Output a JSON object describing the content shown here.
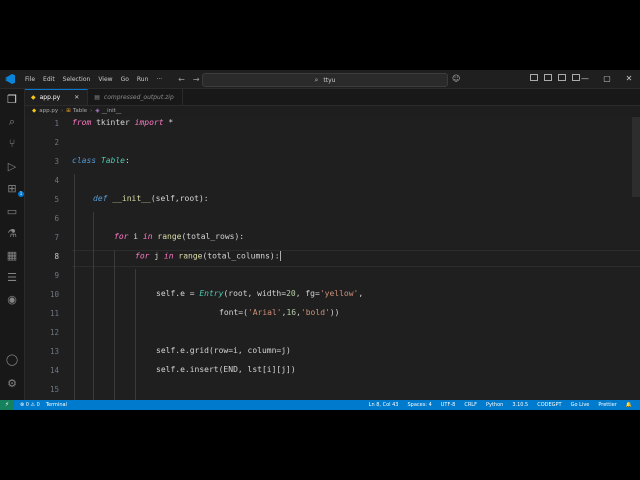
{
  "menu": {
    "file": "File",
    "edit": "Edit",
    "selection": "Selection",
    "view": "View",
    "go": "Go",
    "run": "Run",
    "more": "···"
  },
  "nav": {
    "back": "←",
    "forward": "→"
  },
  "command_center": {
    "text": "ttyu",
    "icon": "search-icon"
  },
  "tabs": [
    {
      "label": "app.py",
      "close": "✕",
      "icon": "python-file-icon"
    },
    {
      "label": "compressed_output.zip",
      "icon": "zip-file-icon"
    }
  ],
  "breadcrumb": {
    "file": "app.py",
    "class": "Table",
    "method": "__init__",
    "sep": "›"
  },
  "code": {
    "l1a": "from",
    "l1b": " tkinter ",
    "l1c": "import",
    "l1d": " *",
    "l3a": "class",
    "l3b": " Table",
    ":": ":",
    "l5a": "def",
    "l5b": "__init__",
    "l5c": "(self,root):",
    "l7a": "for",
    "l7b": " i ",
    "l7c": "in",
    "l7d": "range",
    "l7e": "(total_rows):",
    "l8a": "for",
    "l8b": " j ",
    "l8c": "in",
    "l8d": "range",
    "l8e": "(total_columns):",
    "l10a": "self.e = ",
    "l10b": "Entry",
    "l10c": "(root, width=",
    "l10d": "20",
    ", ": ", ",
    "l10e": "fg",
    "l10f": "=",
    "l10g": "'yellow'",
    "l10h": ",",
    "l11a": "font=(",
    "l11b": "'Arial'",
    "l11c": ",",
    "l11d": "16",
    "l11e": ",",
    "l11f": "'bold'",
    "l11g": "))",
    "l13": "self.e.grid(row=i, column=j)",
    "l14": "self.e.insert(END, lst[i][j])"
  },
  "line_numbers": [
    "1",
    "2",
    "3",
    "4",
    "5",
    "6",
    "7",
    "8",
    "9",
    "10",
    "11",
    "12",
    "13",
    "14",
    "15"
  ],
  "status": {
    "remote": "⚡",
    "problems": "⊗ 0 ⚠ 0",
    "terminal": "Terminal",
    "position": "Ln 8, Col 43",
    "spaces": "Spaces: 4",
    "encoding": "UTF-8",
    "eol": "CRLF",
    "language": "Python",
    "version": "3.10.5",
    "codegpt": "CODEGPT",
    "golive": "Go Live",
    "prettier": "Prettier"
  },
  "colors": {
    "accent": "#007acc",
    "editor_bg": "#1f1f1f",
    "keyword": "#569cd6",
    "class_name": "#4ec9b0",
    "function": "#dcdcaa",
    "string": "#ce9178",
    "number": "#b5cea8"
  }
}
